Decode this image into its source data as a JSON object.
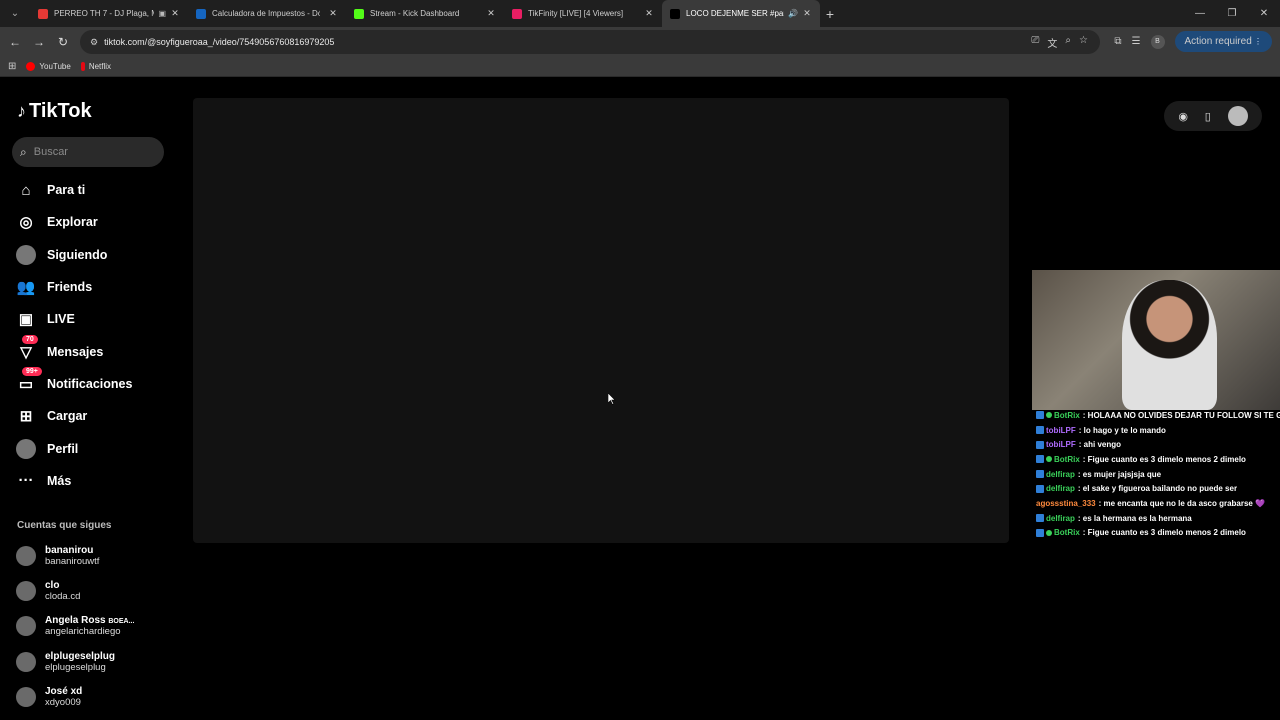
{
  "browser": {
    "tabs": [
      {
        "label": "PERREO TH 7 - DJ Plaga, M",
        "color": "#e53935",
        "extra": "▣"
      },
      {
        "label": "Calculadora de Impuestos - Dó",
        "color": "#1565c0",
        "extra": ""
      },
      {
        "label": "Stream - Kick Dashboard",
        "color": "#53fc18",
        "extra": ""
      },
      {
        "label": "TikFinity [LIVE] [4 Viewers]",
        "color": "#e91e63",
        "extra": ""
      },
      {
        "label": "LOCO DEJENME SER #parat",
        "color": "#000000",
        "extra": "🔊"
      }
    ],
    "url": "tiktok.com/@soyfigueroaa_/video/7549056760816979205",
    "action_required": "Action required",
    "profile_letter": "B",
    "bookmarks": [
      {
        "label": "YouTube",
        "color": "#ff0000"
      },
      {
        "label": "Netflix",
        "color": "#e50914"
      }
    ]
  },
  "tiktok": {
    "logo": "TikTok",
    "search_placeholder": "Buscar",
    "nav": [
      {
        "label": "Para ti",
        "icon": "home-icon",
        "glyph": "⌂",
        "badge": ""
      },
      {
        "label": "Explorar",
        "icon": "compass-icon",
        "glyph": "◎",
        "badge": ""
      },
      {
        "label": "Siguiendo",
        "icon": "following-avatar-icon",
        "glyph": "●",
        "badge": ""
      },
      {
        "label": "Friends",
        "icon": "friends-icon",
        "glyph": "👥",
        "badge": ""
      },
      {
        "label": "LIVE",
        "icon": "live-tv-icon",
        "glyph": "▣",
        "badge": ""
      },
      {
        "label": "Mensajes",
        "icon": "messages-icon",
        "glyph": "▽",
        "badge": "70"
      },
      {
        "label": "Notificaciones",
        "icon": "notifications-icon",
        "glyph": "▭",
        "badge": "99+"
      },
      {
        "label": "Cargar",
        "icon": "upload-icon",
        "glyph": "⊞",
        "badge": ""
      },
      {
        "label": "Perfil",
        "icon": "profile-avatar-icon",
        "glyph": "●",
        "badge": ""
      },
      {
        "label": "Más",
        "icon": "more-icon",
        "glyph": "···",
        "badge": ""
      }
    ],
    "following_title": "Cuentas que sigues",
    "following": [
      {
        "name": "bananirou",
        "handle": "bananirouwtf"
      },
      {
        "name": "clo",
        "handle": "cloda.cd"
      },
      {
        "name": "Angela Ross",
        "name_suffix": "BOEA...",
        "handle": "angelarichardiego"
      },
      {
        "name": "elplugeselplug",
        "handle": "elplugeselplug"
      },
      {
        "name": "José xd",
        "handle": "xdyo009"
      }
    ]
  },
  "chat": [
    {
      "user": "BotRix",
      "color": "#3ad15a",
      "dot": true,
      "msg": ": HOLAAA NO OLVIDES DEJAR TU FOLLOW SI TE GU"
    },
    {
      "user": "tobiLPF",
      "color": "#b06cff",
      "dot": false,
      "msg": ": lo hago y te lo mando"
    },
    {
      "user": "tobiLPF",
      "color": "#b06cff",
      "dot": false,
      "msg": ": ahi vengo"
    },
    {
      "user": "BotRix",
      "color": "#3ad15a",
      "dot": true,
      "msg": ": Figue cuanto es 3 dimelo menos 2 dimelo"
    },
    {
      "user": "delfirap",
      "color": "#3ad15a",
      "dot": false,
      "msg": ": es mujer jajsjsja que"
    },
    {
      "user": "delfirap",
      "color": "#3ad15a",
      "dot": false,
      "msg": ": el sake y figueroa bailando no puede ser"
    },
    {
      "user": "agossstina_333",
      "color": "#ff8a3d",
      "dot": false,
      "msg": ": me encanta que no le da asco grabarse 💜",
      "nocheck": true
    },
    {
      "user": "delfirap",
      "color": "#3ad15a",
      "dot": false,
      "msg": ": es la hermana es la hermana"
    },
    {
      "user": "BotRix",
      "color": "#3ad15a",
      "dot": true,
      "msg": ": Figue cuanto es 3 dimelo menos 2 dimelo"
    }
  ]
}
